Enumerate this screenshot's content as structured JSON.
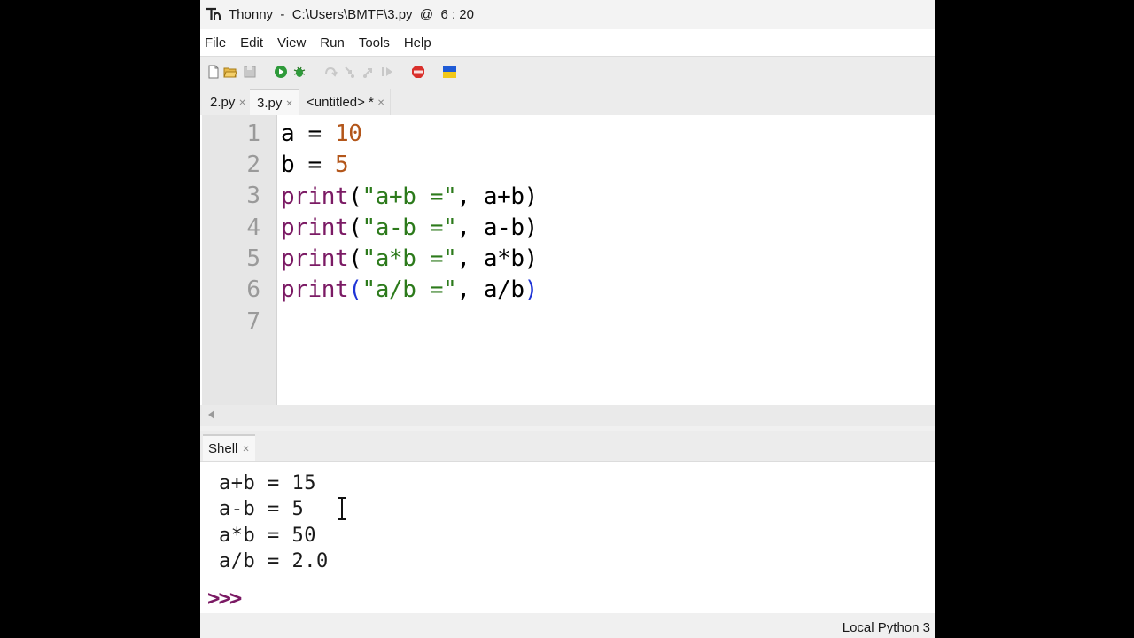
{
  "window": {
    "title": "Thonny  -  C:\\Users\\BMTF\\3.py  @  6 : 20"
  },
  "menu": [
    "File",
    "Edit",
    "View",
    "Run",
    "Tools",
    "Help"
  ],
  "toolbar": {
    "icons": [
      "new-file-icon",
      "open-file-icon",
      "save-icon",
      "run-icon",
      "debug-icon",
      "step-over-icon",
      "step-into-icon",
      "step-out-icon",
      "resume-icon",
      "stop-icon",
      "ukraine-flag-icon"
    ]
  },
  "editor_tabs": [
    {
      "label": "2.py",
      "active": false
    },
    {
      "label": "3.py",
      "active": true
    },
    {
      "label": "<untitled> *",
      "active": false
    }
  ],
  "editor": {
    "line_numbers": [
      "1",
      "2",
      "3",
      "4",
      "5",
      "6",
      "7"
    ],
    "lines": [
      "a = 10",
      "b = 5",
      "print(\"a+b =\", a+b)",
      "print(\"a-b =\", a-b)",
      "print(\"a*b =\", a*b)",
      "print(\"a/b =\", a/b)",
      ""
    ]
  },
  "shell": {
    "tab_label": "Shell",
    "output": [
      "a+b = 15",
      "a-b = 5",
      "a*b = 50",
      "a/b = 2.0"
    ],
    "prompt": ">>>"
  },
  "status": {
    "interpreter": "Local Python 3"
  },
  "colors": {
    "keyword": "#7b1a64",
    "string": "#2c7a1b",
    "number": "#b3561a",
    "matching_paren": "#1f34d6",
    "prompt": "#7b1a64"
  }
}
